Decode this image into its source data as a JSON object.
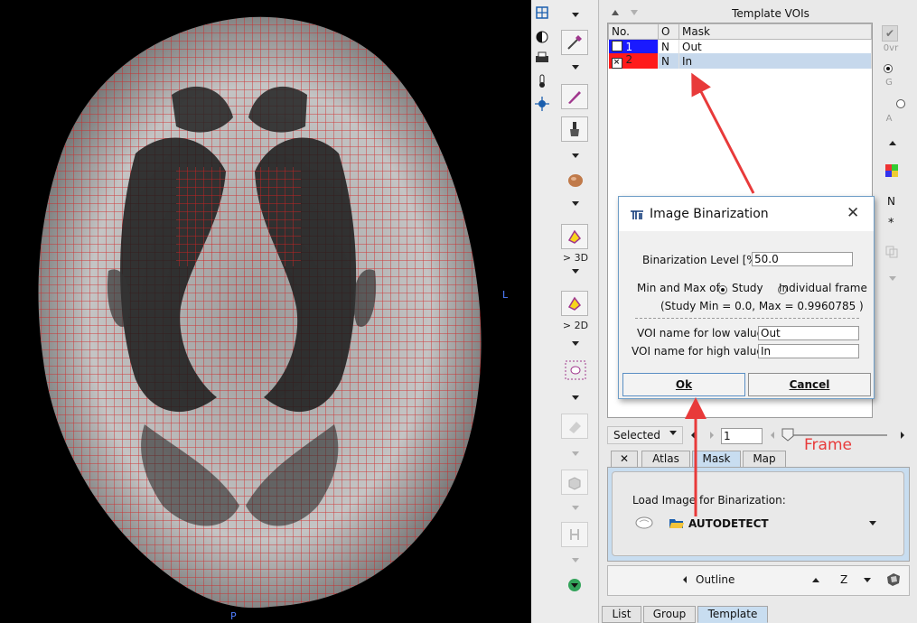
{
  "viewer": {
    "orient_right": "L",
    "orient_bottom": "P"
  },
  "toolbar": {
    "to3d_label": "> 3D",
    "to2d_label": "> 2D"
  },
  "vois_panel": {
    "title": "Template VOIs",
    "columns": [
      "No.",
      "O",
      "Mask"
    ],
    "rows": [
      {
        "no": "1",
        "o": "N",
        "mask": "Out",
        "color": "#1a1aff",
        "checked": false
      },
      {
        "no": "2",
        "o": "N",
        "mask": "In",
        "color": "#ff1a1a",
        "checked": true
      }
    ],
    "side": {
      "ovr": "0vr",
      "g": "G",
      "a": "A",
      "n": "N",
      "star": "*"
    }
  },
  "dialog": {
    "title": "Image Binarization",
    "level_label": "Binarization Level [%]",
    "level_value": "50.0",
    "minmax_label": "Min and Max of:",
    "opt_study": "Study",
    "opt_frame": "Individual frame",
    "study_info": "(Study Min = 0.0, Max = 0.9960785 )",
    "low_label": "VOI name for low values",
    "low_value": "Out",
    "high_label": "VOI name for high values",
    "high_value": "In",
    "ok": "Ok",
    "cancel": "Cancel"
  },
  "frame_ctrl": {
    "selected_label": "Selected",
    "frame_value": "1",
    "annotation": "Frame"
  },
  "mid_tabs": [
    "Atlas",
    "Mask",
    "Map"
  ],
  "mask_box": {
    "load_label": "Load Image for Binarization:",
    "autodetect": "AUTODETECT"
  },
  "outline_bar": {
    "outline_label": "Outline",
    "z_label": "Z"
  },
  "bottom_tabs": [
    "List",
    "Group",
    "Template"
  ],
  "colors": {
    "accent_red": "#e83a3a",
    "tab_active": "#c8ddf0"
  }
}
